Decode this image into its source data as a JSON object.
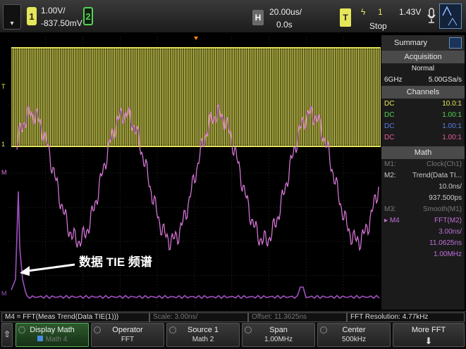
{
  "topbar": {
    "ch1_number": "1",
    "ch1_scale": "1.00V/",
    "ch1_offset": "-837.50mV",
    "ch2_number": "2",
    "h_label": "H",
    "timebase": "20.00us/",
    "delay": "0.0s",
    "t_label": "T",
    "trigger_source": "1",
    "trigger_level": "1.43V",
    "run_state": "Stop"
  },
  "annotation": {
    "text": "数据 TIE 频谱"
  },
  "side_panel": {
    "summary_label": "Summary",
    "acquisition_header": "Acquisition",
    "acq_mode": "Normal",
    "acq_bandwidth": "6GHz",
    "acq_rate": "5.00GSa/s",
    "channels_header": "Channels",
    "channels": [
      {
        "coupling": "DC",
        "probe": "10.0:1",
        "color": "#e6e65a"
      },
      {
        "coupling": "DC",
        "probe": "1.00:1",
        "color": "#56d156"
      },
      {
        "coupling": "DC",
        "probe": "1.00:1",
        "color": "#5a7fe6"
      },
      {
        "coupling": "DC",
        "probe": "1.00:1",
        "color": "#e65a9a"
      }
    ],
    "math_header": "Math",
    "m1_label": "M1:",
    "m1_func": "Clock(Ch1)",
    "m2_label": "M2:",
    "m2_func": "Trend(Data TI...",
    "m2_scale": "10.0ns/",
    "m2_offset": "937.500ps",
    "m3_label": "M3:",
    "m3_func": "Smooth(M1)",
    "m4_label": "M4",
    "m4_func": "FFT(M2)",
    "m4_scale": "3.00ns/",
    "m4_offset": "11.0625ns",
    "m4_span": "1.00MHz"
  },
  "status_bar": {
    "m4_def": "M4 = FFT(Meas Trend(Data TIE(1)))",
    "scale": "Scale: 3.00ns/",
    "offset": "Offset: 11.3625ns",
    "fft_resolution": "FFT Resolution: 4.77kHz"
  },
  "softkeys": [
    {
      "line1": "Display Math",
      "line2": "Math 4"
    },
    {
      "line1": "Operator",
      "line2": "FFT"
    },
    {
      "line1": "Source 1",
      "line2": "Math 2"
    },
    {
      "line1": "Span",
      "line2": "1.00MHz"
    },
    {
      "line1": "Center",
      "line2": "500kHz"
    },
    {
      "line1": "More FFT",
      "line2": ""
    }
  ],
  "colors": {
    "ch1": "#e6e65a",
    "math_trend": "#e07ae0",
    "fft": "#a050c0",
    "accent": "#6a8fbf"
  }
}
